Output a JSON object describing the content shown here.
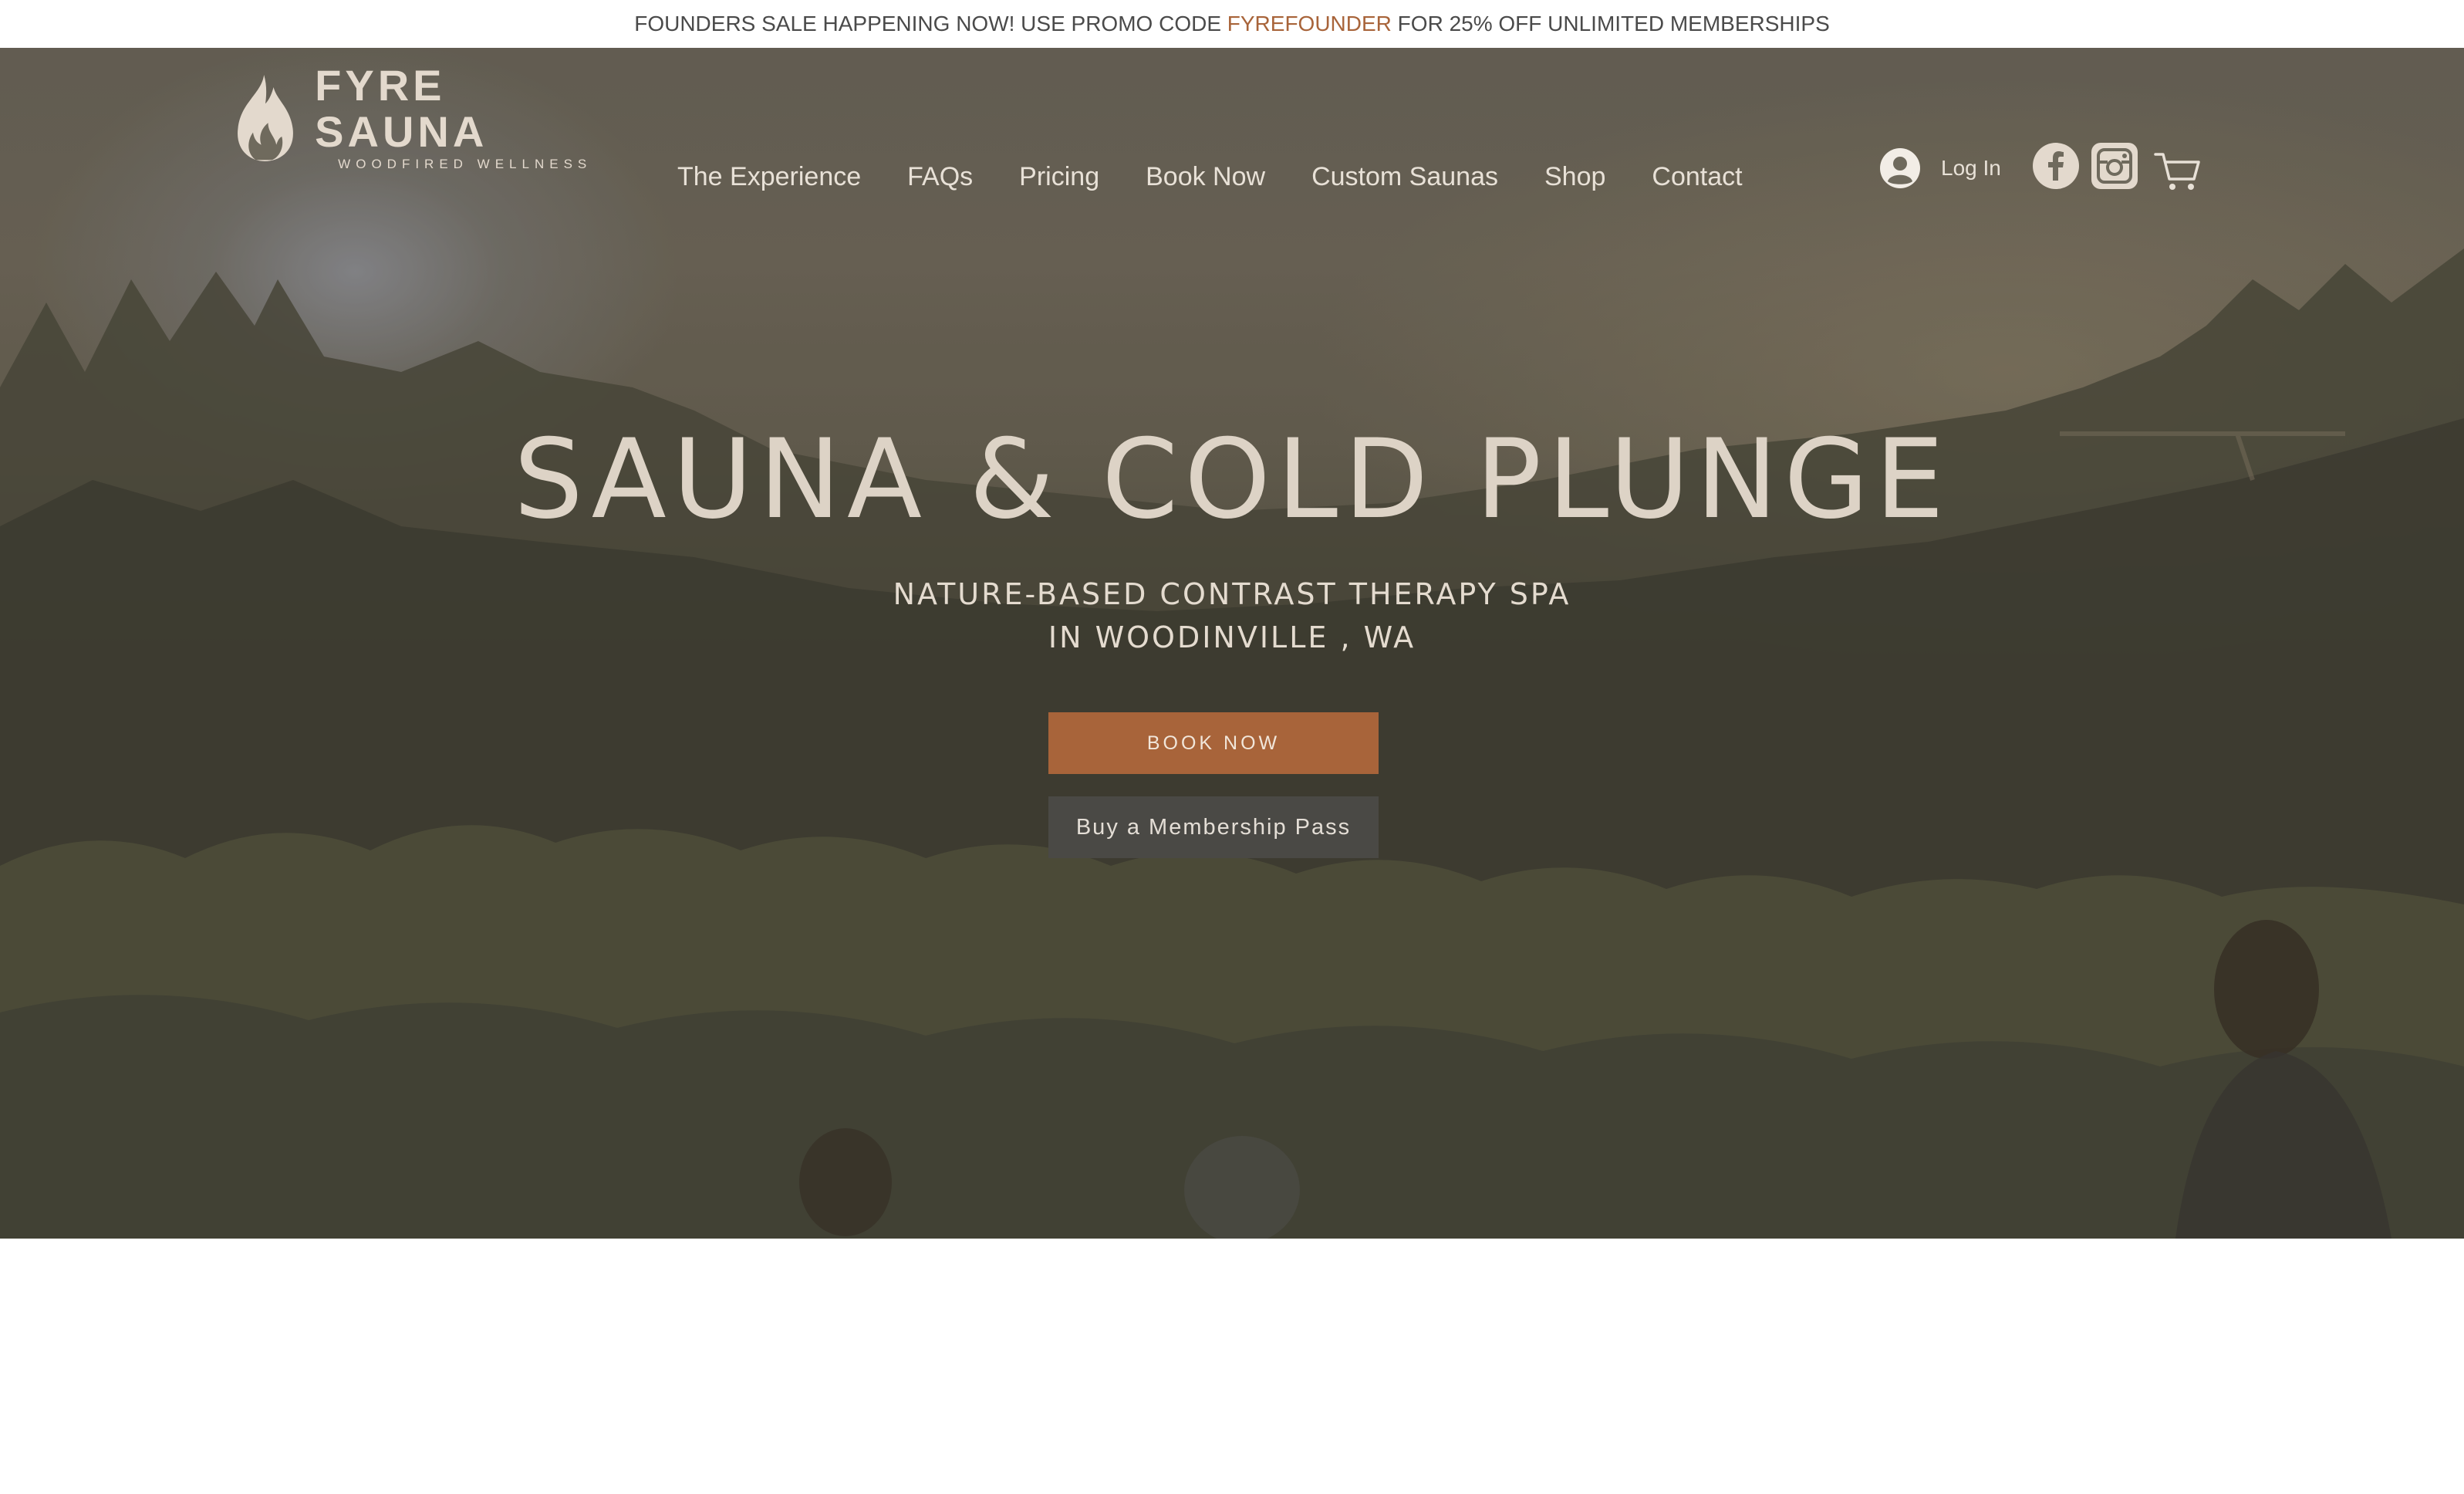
{
  "promo": {
    "before": "FOUNDERS SALE HAPPENING NOW! USE PROMO CODE ",
    "code": "FYREFOUNDER",
    "after": " FOR 25% OFF UNLIMITED MEMBERSHIPS",
    "code_color": "#a8643a"
  },
  "brand": {
    "name": "FYRE SAUNA",
    "tagline": "WOODFIRED WELLNESS",
    "color": "#e3d9cd"
  },
  "nav": {
    "items": [
      {
        "label": "The Experience"
      },
      {
        "label": "FAQs"
      },
      {
        "label": "Pricing"
      },
      {
        "label": "Book Now"
      },
      {
        "label": "Custom Saunas"
      },
      {
        "label": "Shop"
      },
      {
        "label": "Contact"
      }
    ]
  },
  "header_actions": {
    "login_label": "Log In",
    "login_icon": "user-avatar-icon",
    "facebook_icon": "facebook-icon",
    "instagram_icon": "instagram-icon",
    "cart_icon": "cart-icon"
  },
  "hero": {
    "headline": "SAUNA & COLD PLUNGE",
    "subline_1": "NATURE-BASED CONTRAST THERAPY SPA",
    "subline_2": "IN WOODINVILLE , WA",
    "primary_button": "BOOK NOW",
    "secondary_button": "Buy a Membership Pass",
    "accent_color": "#a8643a"
  }
}
